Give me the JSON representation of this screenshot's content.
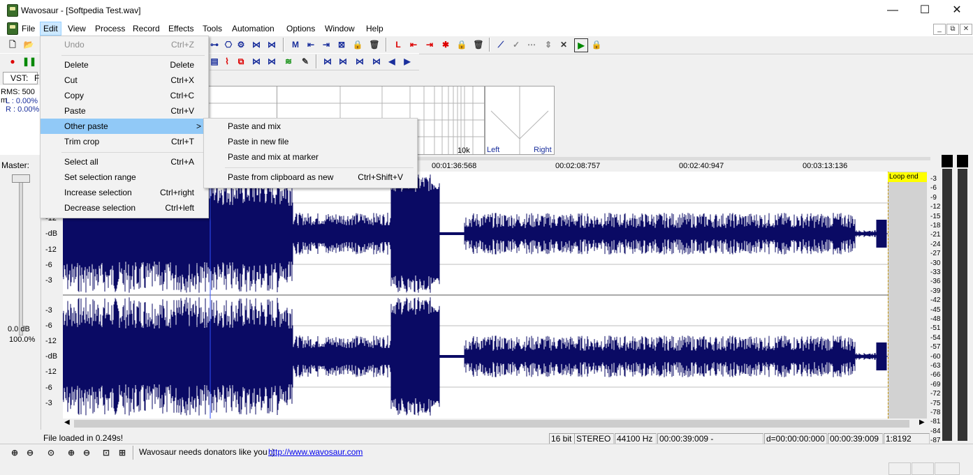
{
  "window": {
    "title": "Wavosaur - [Softpedia Test.wav]",
    "minimize": "—",
    "maximize": "☐",
    "close": "✕"
  },
  "menu": [
    "File",
    "Edit",
    "View",
    "Process",
    "Record",
    "Effects",
    "Tools",
    "Automation",
    "Options",
    "Window",
    "Help"
  ],
  "mdi": {
    "min": "_",
    "restore": "⧉",
    "close": "✕"
  },
  "left_panel": {
    "vst_label": "VST:",
    "vst_value": "F",
    "rms": "RMS: 500 m",
    "l": "L : 0.00%",
    "r": "R : 0.00%",
    "master": "Master:",
    "master_db": "0.0 dB",
    "master_pct": "100.0%"
  },
  "spectrum": {
    "freq_label": "10k",
    "left": "Left",
    "right": "Right"
  },
  "ruler": [
    "00:01:36:568",
    "00:02:08:757",
    "00:02:40:947",
    "00:03:13:136"
  ],
  "loop_end": "Loop end",
  "db_labels": [
    "-12",
    "-12",
    "-6",
    "-3",
    "-3",
    "-6",
    "-12",
    "-dB",
    "-12",
    "-6",
    "-3"
  ],
  "db_top": "-dB",
  "right_db": [
    "-3",
    "-6",
    "-9",
    "-12",
    "-15",
    "-18",
    "-21",
    "-24",
    "-27",
    "-30",
    "-33",
    "-36",
    "-39",
    "-42",
    "-45",
    "-48",
    "-51",
    "-54",
    "-57",
    "-60",
    "-63",
    "-66",
    "-69",
    "-72",
    "-75",
    "-78",
    "-81",
    "-84",
    "-87"
  ],
  "status": {
    "msg": "File loaded in 0.249s!",
    "bits": "16 bit",
    "mode": "STEREO",
    "rate": "44100 Hz",
    "range": "00:00:39:009 - 00:00:39:009",
    "delta": "d=00:00:00:000",
    "pos": "00:00:39:009",
    "zoom": "1:8192"
  },
  "bottom": {
    "donate": "Wavosaur needs donators like you ;)",
    "url": "http://www.wavosaur.com"
  },
  "edit_menu": {
    "undo": {
      "label": "Undo",
      "shortcut": "Ctrl+Z"
    },
    "delete": {
      "label": "Delete",
      "shortcut": "Delete"
    },
    "cut": {
      "label": "Cut",
      "shortcut": "Ctrl+X"
    },
    "copy": {
      "label": "Copy",
      "shortcut": "Ctrl+C"
    },
    "paste": {
      "label": "Paste",
      "shortcut": "Ctrl+V"
    },
    "other_paste": {
      "label": "Other paste",
      "arrow": ">"
    },
    "trim_crop": {
      "label": "Trim crop",
      "shortcut": "Ctrl+T"
    },
    "select_all": {
      "label": "Select all",
      "shortcut": "Ctrl+A"
    },
    "set_selection_range": {
      "label": "Set selection range"
    },
    "increase_selection": {
      "label": "Increase selection",
      "shortcut": "Ctrl+right"
    },
    "decrease_selection": {
      "label": "Decrease selection",
      "shortcut": "Ctrl+left"
    }
  },
  "paste_submenu": {
    "paste_and_mix": "Paste and mix",
    "paste_in_new_file": "Paste in new file",
    "paste_and_mix_at_marker": "Paste and mix at marker",
    "paste_from_clipboard": {
      "label": "Paste from clipboard as new",
      "shortcut": "Ctrl+Shift+V"
    }
  },
  "colors": {
    "waveform": "#0a0a64",
    "selection": "#d2d2d2",
    "loop_marker": "#ffff00",
    "menu_highlight": "#91c9f7"
  }
}
